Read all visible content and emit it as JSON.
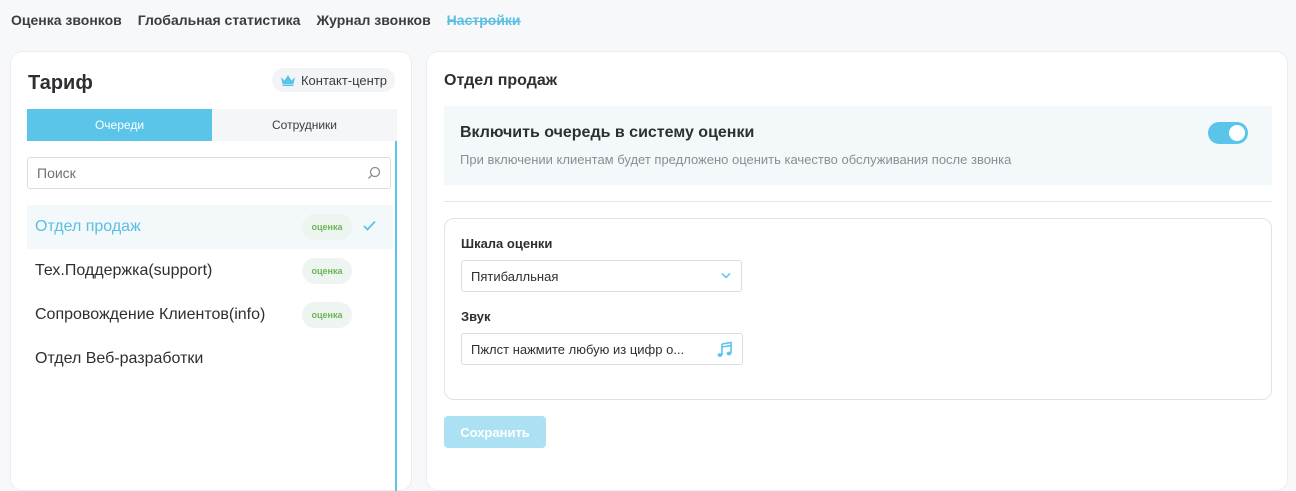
{
  "nav": {
    "links": [
      "Оценка звонков",
      "Глобальная статистика",
      "Журнал звонков",
      "Настройки"
    ],
    "active_index": 3
  },
  "left_panel": {
    "title": "Тариф",
    "plan_badge": {
      "label": "Контакт-центр",
      "icon": "crown-icon"
    },
    "tabs": [
      "Очереди",
      "Сотрудники"
    ],
    "active_tab": 0,
    "search": {
      "placeholder": "Поиск",
      "value": ""
    },
    "queues": [
      {
        "name": "Отдел продаж",
        "badge": "оценка",
        "selected": true,
        "checked": true
      },
      {
        "name": "Тех.Поддержка(support)",
        "badge": "оценка",
        "selected": false,
        "checked": false
      },
      {
        "name": "Сопровождение Клиентов(info)",
        "badge": "оценка",
        "selected": false,
        "checked": false
      },
      {
        "name": "Отдел Веб-разработки",
        "badge": "",
        "selected": false,
        "checked": false
      }
    ]
  },
  "right_panel": {
    "title": "Отдел продаж",
    "toggle": {
      "title": "Включить очередь в систему оценки",
      "description": "При включении клиентам будет предложено оценить качество обслуживания после звонка",
      "enabled": true
    },
    "scale": {
      "label": "Шкала оценки",
      "value": "Пятибалльная"
    },
    "sound": {
      "label": "Звук",
      "value": "Пжлст нажмите любую из цифр о...",
      "icon": "music-icon"
    },
    "save_label": "Сохранить"
  },
  "colors": {
    "accent": "#5bc4e9",
    "badge_text": "#6cb657",
    "save_disabled": "#ace1f4"
  }
}
